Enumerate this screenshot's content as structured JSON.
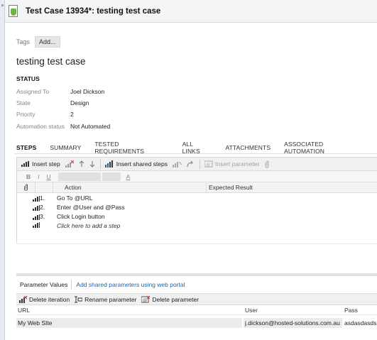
{
  "window": {
    "title": "Test Case 13934*: testing test case"
  },
  "tags": {
    "label": "Tags",
    "add_label": "Add..."
  },
  "test_case": {
    "title": "testing test case"
  },
  "status": {
    "heading": "STATUS",
    "fields": [
      {
        "label": "Assigned To",
        "value": "Joel Dickson"
      },
      {
        "label": "State",
        "value": "Design"
      },
      {
        "label": "Priority",
        "value": "2"
      },
      {
        "label": "Automation status",
        "value": "Not Automated"
      }
    ]
  },
  "tabs": [
    "STEPS",
    "SUMMARY",
    "TESTED REQUIREMENTS",
    "ALL LINKS",
    "ATTACHMENTS",
    "ASSOCIATED AUTOMATION"
  ],
  "steps_toolbar": {
    "insert_step": "Insert step",
    "insert_shared_steps": "Insert shared steps",
    "insert_parameter": "Insert parameter"
  },
  "format_toolbar": {
    "bold": "B",
    "italic": "I",
    "underline": "U",
    "font_color": "A"
  },
  "steps_table": {
    "headers": {
      "action": "Action",
      "expected": "Expected Result"
    },
    "rows": [
      {
        "num": "1.",
        "action": "Go To @URL"
      },
      {
        "num": "2.",
        "action": "Enter @User and @Pass"
      },
      {
        "num": "3.",
        "action": "Click Login button"
      }
    ],
    "add_step": "Click here to add a step"
  },
  "parameters": {
    "tab_label": "Parameter Values",
    "link_label": "Add shared parameters using web portal",
    "toolbar": {
      "delete_iteration": "Delete iteration",
      "rename_parameter": "Rename parameter",
      "delete_parameter": "Delete parameter"
    },
    "headers": [
      "URL",
      "User",
      "Pass"
    ],
    "rows": [
      [
        "My Web SIte",
        "j.dickson@hosted-solutions.com.au",
        "asdasdasds"
      ]
    ]
  }
}
